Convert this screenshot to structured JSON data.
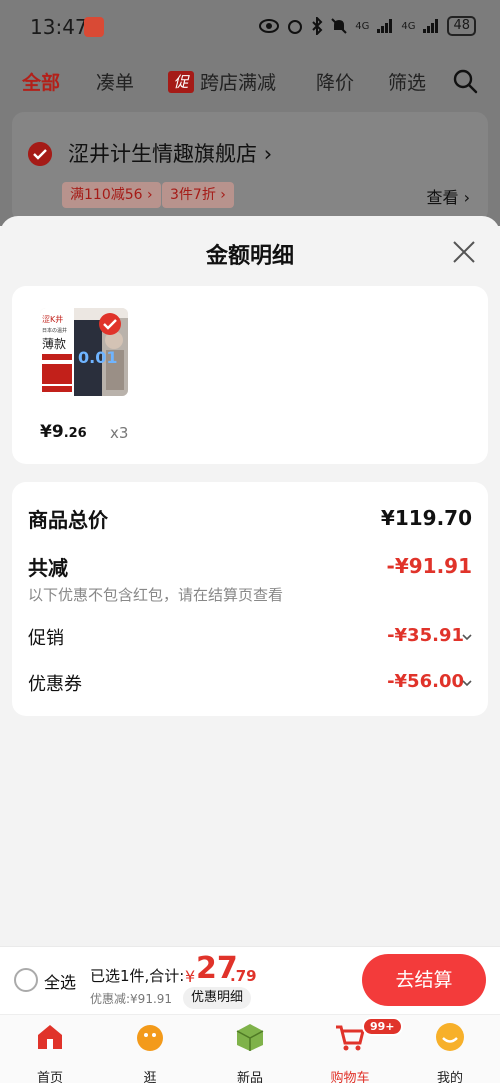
{
  "status_bar": {
    "time": "13:47",
    "battery": "48",
    "signal_1": "4G",
    "signal_2": "4G"
  },
  "tabs": [
    {
      "label": "全部"
    },
    {
      "label": "凑单"
    },
    {
      "label": "跨店满减",
      "badge": "促"
    },
    {
      "label": "降价"
    },
    {
      "label": "筛选"
    }
  ],
  "store": {
    "name": "涩井计生情趣旗舰店",
    "name_chevron": "›",
    "coupons": [
      "满110减56 ›",
      "3件7折 ›"
    ],
    "view_label": "查看 ›"
  },
  "sheet": {
    "title": "金额明细",
    "product": {
      "price_symbol": "¥",
      "price_int": "9",
      "price_dec": ".26",
      "quantity": "x3",
      "package_text": [
        "涩K井",
        "日本の温井",
        "薄款",
        "0.01"
      ]
    },
    "summary": {
      "total_label": "商品总价",
      "total_value": "¥119.70",
      "reduce_label": "共减",
      "reduce_value": "-¥91.91",
      "note": "以下优惠不包含红包，请在结算页查看",
      "promo_label": "促销",
      "promo_value": "-¥35.91",
      "coupon_label": "优惠券",
      "coupon_value": "-¥56.00"
    }
  },
  "bottom_bar": {
    "select_all": "全选",
    "selected_text": "已选1件,合计:",
    "total_yen": "¥",
    "total_int": "27",
    "total_dec": ".79",
    "discount_text": "优惠减:¥91.91",
    "detail_button": "优惠明细",
    "checkout_button": "去结算"
  },
  "tabbar": [
    {
      "label": "首页"
    },
    {
      "label": "逛"
    },
    {
      "label": "新品"
    },
    {
      "label": "购物车",
      "badge": "99+"
    },
    {
      "label": "我的"
    }
  ],
  "colors": {
    "accent": "#e0332a",
    "checkout": "#f33b3b",
    "overlay": "#7c7c7c"
  }
}
